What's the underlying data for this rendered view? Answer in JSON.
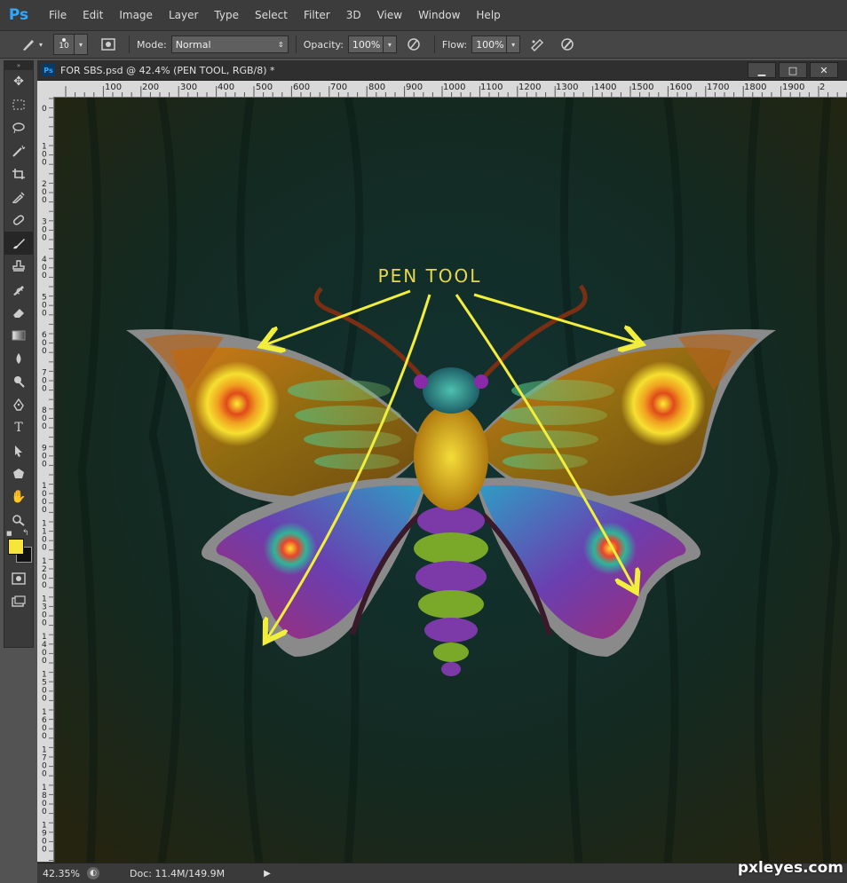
{
  "app": {
    "logo": "Ps"
  },
  "menu": [
    "File",
    "Edit",
    "Image",
    "Layer",
    "Type",
    "Select",
    "Filter",
    "3D",
    "View",
    "Window",
    "Help"
  ],
  "options": {
    "brush_size": "10",
    "mode_label": "Mode:",
    "mode_value": "Normal",
    "opacity_label": "Opacity:",
    "opacity_value": "100%",
    "flow_label": "Flow:",
    "flow_value": "100%"
  },
  "document": {
    "title": "FOR SBS.psd @ 42.4% (PEN TOOL, RGB/8) *",
    "icon": "Ps",
    "minimize": "▁",
    "restore": "□",
    "close": "✕"
  },
  "ruler": {
    "h_ticks": [
      "100",
      "200",
      "300",
      "400",
      "500",
      "600",
      "700",
      "800",
      "900",
      "1000",
      "1100",
      "1200",
      "1300",
      "1400",
      "1500",
      "1600",
      "1700",
      "1800",
      "1900",
      "2"
    ],
    "v_ticks": [
      "0",
      "1 0 0",
      "2 0 0",
      "3 0 0",
      "4 0 0",
      "5 0 0",
      "6 0 0",
      "7 0 0",
      "8 0 0",
      "9 0 0",
      "1 0 0 0",
      "1 1 0 0",
      "1 2 0 0",
      "1 3 0 0",
      "1 4 0 0",
      "1 5 0 0",
      "1 6 0 0",
      "1 7 0 0",
      "1 8 0 0",
      "1 9 0 0"
    ]
  },
  "canvas": {
    "annotation": "PEN TOOL"
  },
  "status": {
    "zoom": "42.35%",
    "doc_info": "Doc: 11.4M/149.9M",
    "arrow": "▶"
  },
  "watermark": "pxleyes.com",
  "colors": {
    "foreground": "#f7e53b",
    "background": "#111111",
    "annotation": "#f1ee3c"
  },
  "tools": [
    "move-icon",
    "marquee-icon",
    "lasso-icon",
    "magic-wand-icon",
    "crop-icon",
    "eyedropper-icon",
    "healing-icon",
    "brush-icon",
    "stamp-icon",
    "history-brush-icon",
    "eraser-icon",
    "gradient-icon",
    "blur-icon",
    "dodge-icon",
    "pen-icon",
    "type-icon",
    "path-select-icon",
    "shape-icon",
    "hand-icon",
    "zoom-icon"
  ]
}
